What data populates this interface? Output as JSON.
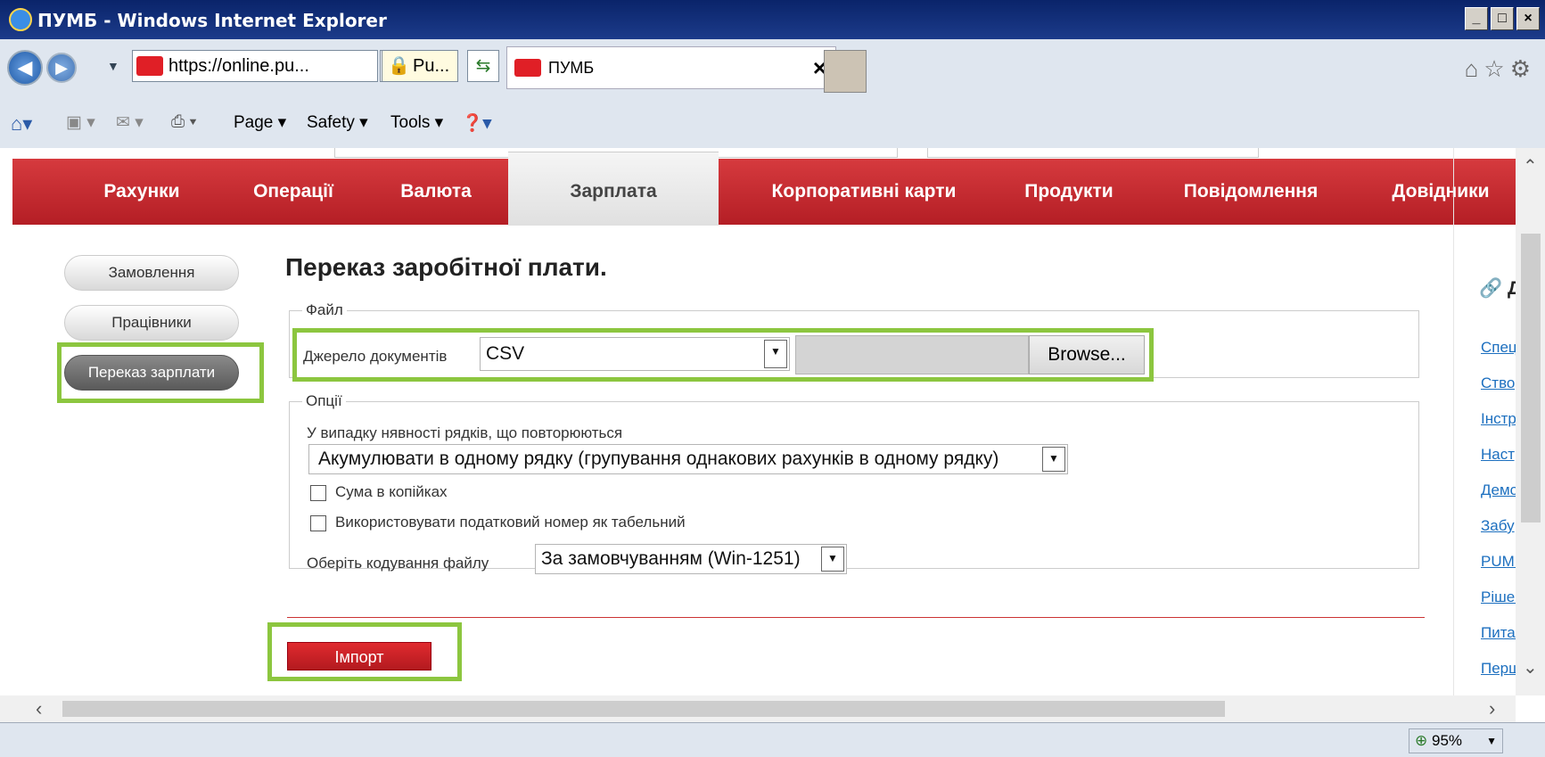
{
  "window": {
    "title": "ПУМБ - Windows Internet Explorer"
  },
  "browser": {
    "url": "https://online.pu...",
    "cert_label": "Pu...",
    "tab_title": "ПУМБ",
    "bank_badge": "ПУМБ",
    "command_bar": {
      "page": "Page ▾",
      "safety": "Safety ▾",
      "tools": "Tools ▾"
    },
    "zoom": "95%"
  },
  "menu": {
    "items": [
      "Рахунки",
      "Операції",
      "Валюта",
      "Зарплата",
      "Корпоративні карти",
      "Продукти",
      "Повідомлення",
      "Довідники"
    ],
    "active": "Зарплата"
  },
  "sidebar": {
    "items": [
      "Замовлення",
      "Працівники",
      "Переказ зарплати"
    ],
    "active": "Переказ зарплати"
  },
  "main": {
    "title": "Переказ заробітної плати.",
    "file_section": {
      "legend": "Файл",
      "source_label": "Джерело документів",
      "source_value": "CSV",
      "browse_label": "Browse..."
    },
    "options_section": {
      "legend": "Опції",
      "duplicates_label": "У випадку нявності рядків, що повторюються",
      "duplicates_value": "Акумулювати в одному рядку (групування однакових рахунків в одному рядку)",
      "checkbox_kopecks": "Сума в копійках",
      "checkbox_taxnum": "Використовувати податковий номер як табельний",
      "encoding_label": "Оберіть кодування файлу",
      "encoding_value": "За замовчуванням (Win-1251)"
    },
    "import_label": "Імпорт"
  },
  "right_panel": {
    "heading": "Де",
    "links": [
      "Спец",
      "Створ",
      "Інстр",
      "Настр",
      "Демо",
      "Забу",
      "PUMB",
      "Рішен",
      "Питан",
      "Перш"
    ]
  },
  "colors": {
    "menu_red": "#c62a2f",
    "highlight_green": "#8cc63f",
    "link_blue": "#1c6fbf"
  }
}
